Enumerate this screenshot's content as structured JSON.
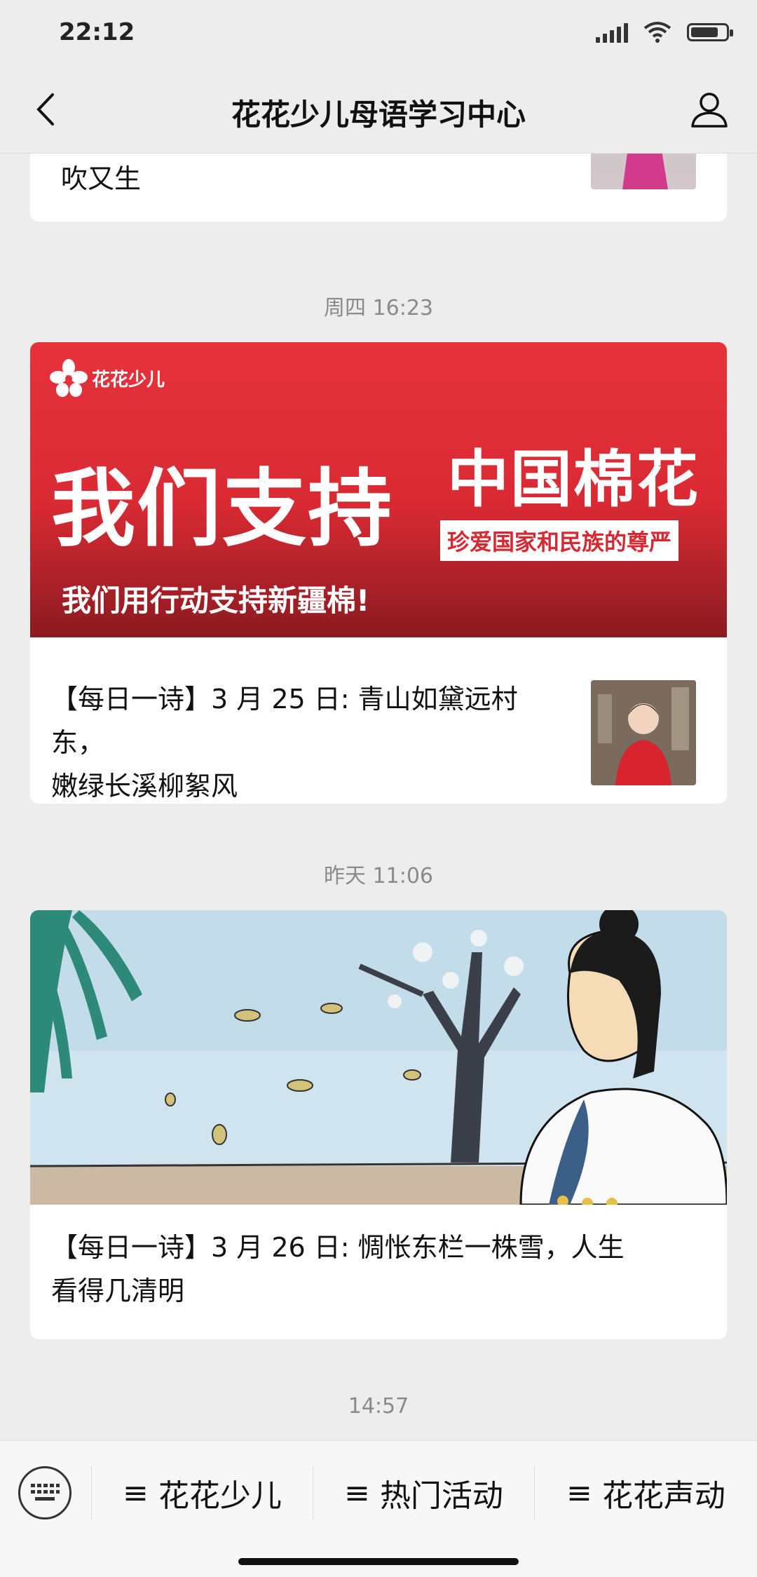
{
  "status_bar": {
    "time": "22:12"
  },
  "header": {
    "title": "花花少儿母语学习中心"
  },
  "feed": {
    "top_card": {
      "text": "吹又生"
    },
    "timestamp_1": "周四 16:23",
    "banner": {
      "logo_text": "花花少儿",
      "line_left": "我们支持",
      "line_right": "中国棉花",
      "tagline": "珍爱国家和民族的尊严",
      "bottom_text": "我们用行动支持新疆棉!"
    },
    "article_1": {
      "text_line1": "【每日一诗】3 月 25 日: 青山如黛远村东，",
      "text_line2": "嫩绿长溪柳絮风"
    },
    "timestamp_2": "昨天 11:06",
    "article_2": {
      "text_line1": "【每日一诗】3 月 26 日: 惆怅东栏一株雪，人生",
      "text_line2": "看得几清明"
    },
    "timestamp_3": "14:57"
  },
  "menu": {
    "items": [
      {
        "label": "花花少儿"
      },
      {
        "label": "热门活动"
      },
      {
        "label": "花花声动"
      }
    ]
  },
  "colors": {
    "brand_red": "#e6323b",
    "background": "#ededed"
  }
}
